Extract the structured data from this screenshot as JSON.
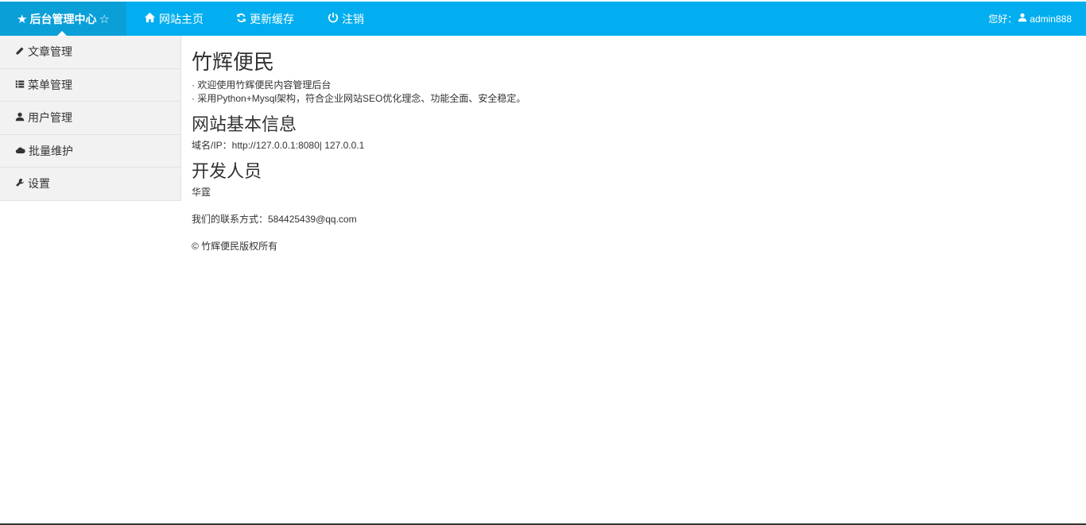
{
  "header": {
    "brand_star_left": "★",
    "brand_title": "后台管理中心",
    "brand_star_right": "☆",
    "nav": [
      {
        "label": "网站主页",
        "icon": "home-icon"
      },
      {
        "label": "更新缓存",
        "icon": "refresh-icon"
      },
      {
        "label": "注销",
        "icon": "power-icon"
      }
    ],
    "greeting_label": "您好：",
    "username": "admin888",
    "bar_color": "#02aeef"
  },
  "sidebar": {
    "items": [
      {
        "label": "文章管理",
        "icon": "pencil-icon"
      },
      {
        "label": "菜单管理",
        "icon": "list-icon"
      },
      {
        "label": "用户管理",
        "icon": "user-icon"
      },
      {
        "label": "批量维护",
        "icon": "cloud-icon"
      },
      {
        "label": "设置",
        "icon": "wrench-icon"
      }
    ]
  },
  "main": {
    "title": "竹辉便民",
    "intro_lines": [
      "欢迎使用竹辉便民内容管理后台",
      "采用Python+Mysql架构，符合企业网站SEO优化理念、功能全面、安全稳定。"
    ],
    "site_info_heading": "网站基本信息",
    "site_info_text": "域名/IP：http://127.0.0.1:8080| 127.0.0.1",
    "developers_heading": "开发人员",
    "developer_name": "华霆",
    "contact_text": "我们的联系方式：584425439@qq.com",
    "copyright": "© 竹辉便民版权所有"
  }
}
